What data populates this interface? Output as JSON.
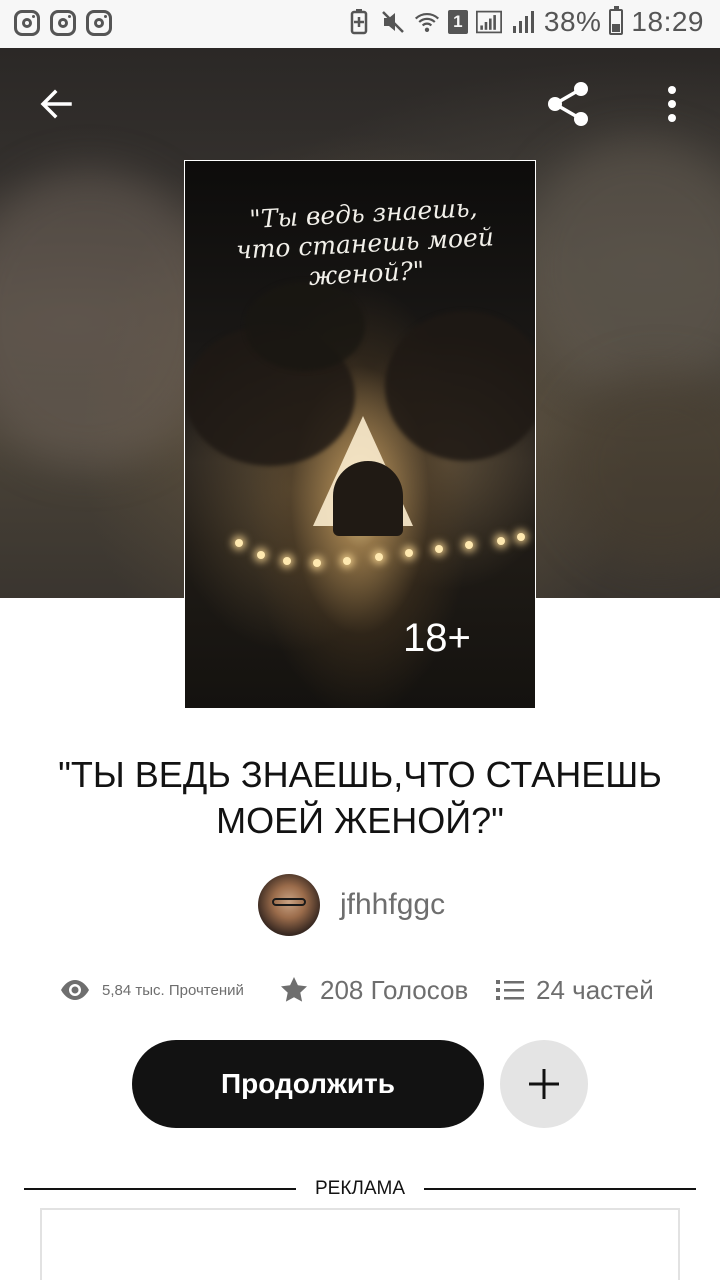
{
  "status_bar": {
    "notification_icons": [
      "instagram-icon",
      "instagram-icon",
      "instagram-icon"
    ],
    "sim_badge": "1",
    "battery_percent": "38%",
    "battery_level": 0.38,
    "time": "18:29"
  },
  "header": {
    "back_icon": "arrow-left-icon",
    "share_icon": "share-icon",
    "more_icon": "more-vertical-icon"
  },
  "cover": {
    "quote": "\"Ты ведь знаешь, что станешь моей женой?\"",
    "age_rating": "18+"
  },
  "story": {
    "title": "\"ТЫ ВЕДЬ ЗНАЕШЬ,ЧТО СТАНЕШЬ МОЕЙ ЖЕНОЙ?\"",
    "author": "jfhhfggc"
  },
  "stats": {
    "reads": "5,84 тыс. Прочтений",
    "votes": "208 Голосов",
    "parts": "24 частей"
  },
  "actions": {
    "continue_label": "Продолжить",
    "add_icon": "plus-icon"
  },
  "ad": {
    "label": "РЕКЛАМА"
  },
  "colors": {
    "primary_button": "#121212",
    "secondary_button": "#e4e4e4",
    "muted_text": "#6e6e6e"
  }
}
